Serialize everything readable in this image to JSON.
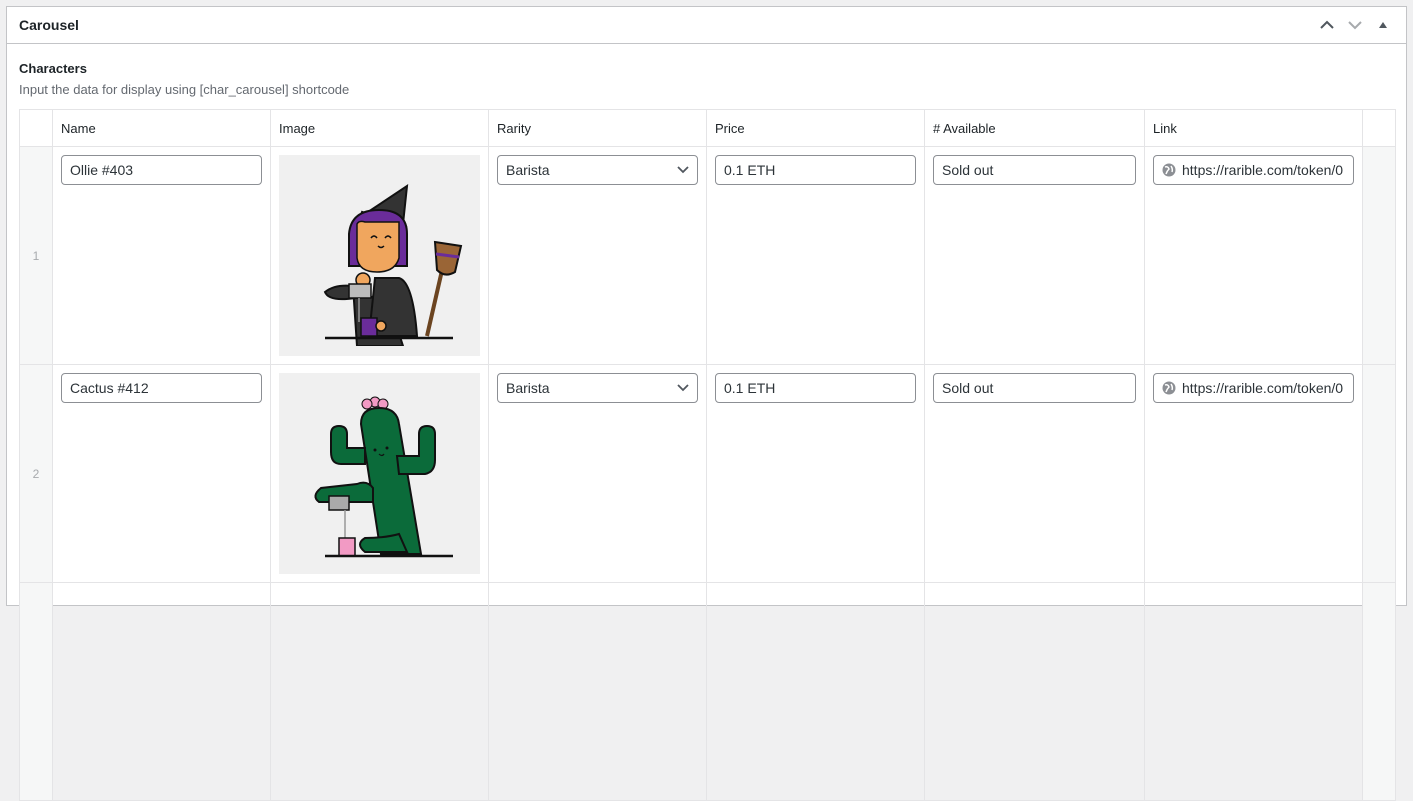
{
  "metabox": {
    "title": "Carousel",
    "controls": {
      "move_up": "chevron-up",
      "move_down": "chevron-down",
      "toggle": "triangle-up"
    }
  },
  "field": {
    "label": "Characters",
    "description": "Input the data for display using [char_carousel] shortcode"
  },
  "table": {
    "columns": [
      "Name",
      "Image",
      "Rarity",
      "Price",
      "# Available",
      "Link"
    ],
    "rows": [
      {
        "index": "1",
        "name": "Ollie #403",
        "image": "witch-barista",
        "rarity": "Barista",
        "price": "0.1 ETH",
        "available": "Sold out",
        "link": "https://rarible.com/token/0"
      },
      {
        "index": "2",
        "name": "Cactus #412",
        "image": "cactus-barista",
        "rarity": "Barista",
        "price": "0.1 ETH",
        "available": "Sold out",
        "link": "https://rarible.com/token/0"
      }
    ]
  },
  "colors": {
    "witch_hair": "#6a2c9a",
    "witch_skin": "#f0a65e",
    "witch_clothes": "#333333",
    "cactus_green": "#0b6b3a",
    "cactus_flower": "#f29ac4"
  }
}
